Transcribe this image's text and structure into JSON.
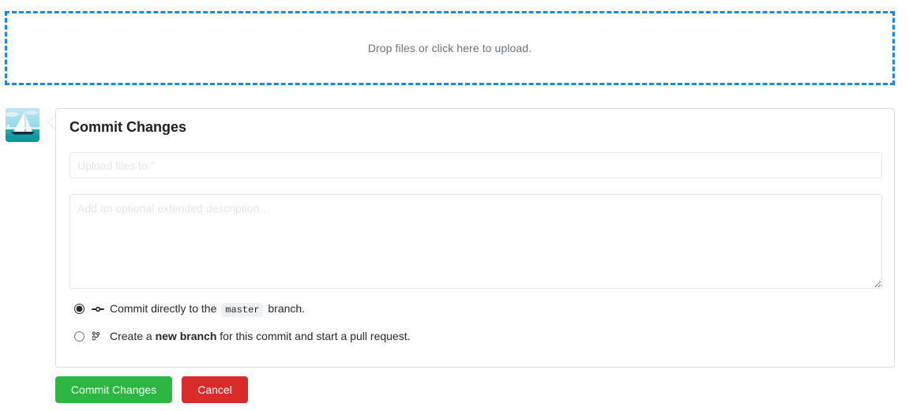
{
  "dropzone": {
    "text": "Drop files or click here to upload.",
    "border_color": "#1c87ea"
  },
  "avatar": {
    "alt": "user avatar sailboat photo"
  },
  "panel": {
    "title": "Commit Changes",
    "summary": {
      "placeholder": "Upload files to ''",
      "value": ""
    },
    "description": {
      "placeholder": "Add an optional extended description…",
      "value": ""
    },
    "options": [
      {
        "icon": "git-commit-icon",
        "label_before": "Commit directly to the",
        "branch": "master",
        "label_after": "branch.",
        "selected": true
      },
      {
        "icon": "git-branch-icon",
        "label_before": "Create a",
        "emphasis": "new branch",
        "label_after": "for this commit and start a pull request.",
        "selected": false
      }
    ]
  },
  "actions": {
    "commit_label": "Commit Changes",
    "cancel_label": "Cancel",
    "commit_color": "#2cb742",
    "cancel_color": "#da2b2b"
  }
}
